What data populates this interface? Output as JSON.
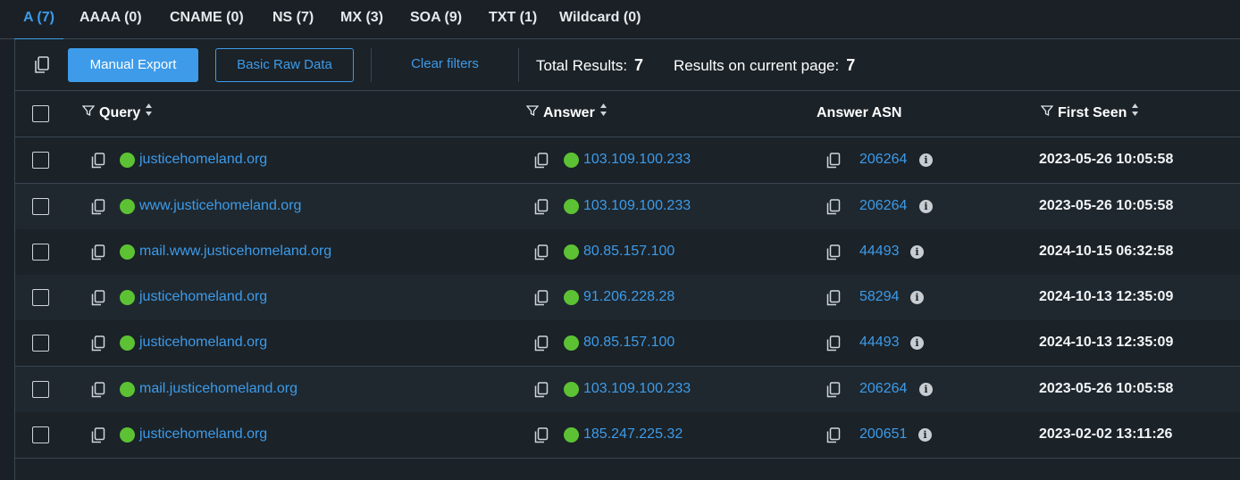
{
  "tabs": [
    {
      "label": "A (7)",
      "active": true
    },
    {
      "label": "AAAA (0)"
    },
    {
      "label": "CNAME (0)"
    },
    {
      "label": "NS (7)"
    },
    {
      "label": "MX (3)"
    },
    {
      "label": "SOA (9)"
    },
    {
      "label": "TXT (1)"
    },
    {
      "label": "Wildcard (0)"
    }
  ],
  "toolbar": {
    "copy_icon": "copy-icon",
    "manual_export": "Manual Export",
    "basic_raw_data": "Basic Raw Data",
    "clear_filters": "Clear filters",
    "total_results_label": "Total Results:",
    "total_results_value": "7",
    "results_page_label": "Results on current page:",
    "results_page_value": "7"
  },
  "columns": {
    "query": "Query",
    "answer": "Answer",
    "answer_asn": "Answer ASN",
    "first_seen": "First Seen"
  },
  "rows": [
    {
      "query": "justicehomeland.org",
      "answer": "103.109.100.233",
      "asn": "206264",
      "first_seen": "2023-05-26 10:05:58"
    },
    {
      "query": "www.justicehomeland.org",
      "answer": "103.109.100.233",
      "asn": "206264",
      "first_seen": "2023-05-26 10:05:58"
    },
    {
      "query": "mail.www.justicehomeland.org",
      "answer": "80.85.157.100",
      "asn": "44493",
      "first_seen": "2024-10-15 06:32:58"
    },
    {
      "query": "justicehomeland.org",
      "answer": "91.206.228.28",
      "asn": "58294",
      "first_seen": "2024-10-13 12:35:09"
    },
    {
      "query": "justicehomeland.org",
      "answer": "80.85.157.100",
      "asn": "44493",
      "first_seen": "2024-10-13 12:35:09"
    },
    {
      "query": "mail.justicehomeland.org",
      "answer": "103.109.100.233",
      "asn": "206264",
      "first_seen": "2023-05-26 10:05:58"
    },
    {
      "query": "justicehomeland.org",
      "answer": "185.247.225.32",
      "asn": "200651",
      "first_seen": "2023-02-02 13:11:26"
    }
  ],
  "colors": {
    "accent": "#3d9be9",
    "status_ok": "#5cc234",
    "background": "#1a2026"
  }
}
